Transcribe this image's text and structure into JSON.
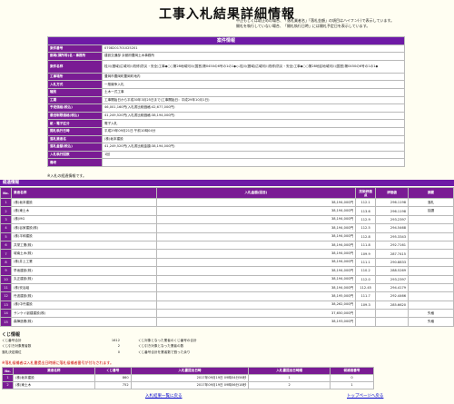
{
  "page": {
    "title": "工事入札結果詳細情報",
    "notes": [
      "中止もしくは取止めの場合、「落札業者名」「落札金額」の項目はハイフン(-)で表示しています。",
      "開札を執行していない場合、「開札執行日時」には開札予定日を表示しています。"
    ]
  },
  "info": {
    "header": "案件情報",
    "rows": [
      {
        "label": "案件番号",
        "value": "0708201701025201"
      },
      {
        "label": "部局(課所等)名・事務所",
        "value": "建設交通部 京都府豊岡土木事務所"
      },
      {
        "label": "案件名称",
        "value": "桂川(圏域)広域河川改修(防災・安全)工事◆○○第28地域河川(国営)第0450の6号の1の1◆◇-桂川(圏域)広域河川改修(防災・安全)工事◆○○第28地区地域河川(国営)第0450の6号の1の1◆"
      },
      {
        "label": "工事場所",
        "value": "豊岡市豊岡町豊岡町地内"
      },
      {
        "label": "入札方式",
        "value": "一般競争入札"
      },
      {
        "label": "種別",
        "value": "土木一式工事"
      },
      {
        "label": "工期",
        "value": "工事開始日から平成30年3月25日まで(工事開始日：平成29年10月1日)"
      },
      {
        "label": "予定価格(税込)",
        "value": "46,001,160円(入札書比較価格:42,677,000円)"
      },
      {
        "label": "最低制限価格(税込)",
        "value": "41,249,520円(入札書比較価格:38,194,000円)"
      },
      {
        "label": "紙・電子区分",
        "value": "電子入札"
      },
      {
        "label": "開札執行日時",
        "value": "平成29年09月21日 午前10時04分"
      },
      {
        "label": "落札業者名",
        "value": "(株)坂本建設"
      },
      {
        "label": "落札金額(税込)",
        "value": "41,249,520円(入札書比較金額:38,194,000円)"
      },
      {
        "label": "入札執行回数",
        "value": "1回"
      },
      {
        "label": "備考",
        "value": ""
      }
    ]
  },
  "caption_kekka": "※入札の経過情報です。",
  "kekka": {
    "section_title": "経過情報",
    "headers": {
      "no": "No.",
      "name": "業者名称",
      "amount": "入札金額(回目)",
      "score": "技術評価点",
      "eval": "評価値",
      "note": "摘要"
    },
    "rows": [
      {
        "no": "1",
        "name": "(株)坂本建設",
        "amount": "38,194,000円",
        "score": "112.1",
        "eval": "296.1198",
        "note": "落札"
      },
      {
        "no": "2",
        "name": "(株)東土木",
        "amount": "38,194,000円",
        "score": "113.6",
        "eval": "296.1198",
        "note": "抽選"
      },
      {
        "no": "3",
        "name": "(株)MG",
        "amount": "38,194,000円",
        "score": "112.9",
        "eval": "293.2397",
        "note": ""
      },
      {
        "no": "4",
        "name": "(株)谷家建設(株)",
        "amount": "38,194,000円",
        "score": "112.5",
        "eval": "294.5468",
        "note": ""
      },
      {
        "no": "5",
        "name": "(株)平和建設",
        "amount": "38,194,000円",
        "score": "112.8",
        "eval": "295.3343",
        "note": ""
      },
      {
        "no": "6",
        "name": "共栄工業(株)",
        "amount": "38,194,000円",
        "score": "111.8",
        "eval": "292.7161",
        "note": ""
      },
      {
        "no": "7",
        "name": "城南土木(株)",
        "amount": "38,194,000円",
        "score": "109.9",
        "eval": "287.7415",
        "note": ""
      },
      {
        "no": "8",
        "name": "(株)井上工業",
        "amount": "38,194,000円",
        "score": "111.1",
        "eval": "290.8833",
        "note": ""
      },
      {
        "no": "9",
        "name": "早坂建設(株)",
        "amount": "38,194,000円",
        "score": "110.2",
        "eval": "288.5269",
        "note": ""
      },
      {
        "no": "10",
        "name": "丸正建設(株)",
        "amount": "38,194,000円",
        "score": "112.0",
        "eval": "293.2397",
        "note": ""
      },
      {
        "no": "11",
        "name": "(株)安谷組",
        "amount": "38,194,000円",
        "score": "112.45",
        "eval": "294.4179",
        "note": ""
      },
      {
        "no": "12",
        "name": "丹波建設(株)",
        "amount": "38,195,000円",
        "score": "111.7",
        "eval": "292.4466",
        "note": ""
      },
      {
        "no": "13",
        "name": "(株)中丹建設",
        "amount": "38,262,000円",
        "score": "109.3",
        "eval": "285.6620",
        "note": ""
      },
      {
        "no": "14",
        "name": "サンケイ創建建設(株)",
        "amount": "37,650,000円",
        "score": "",
        "eval": "",
        "note": "失格"
      },
      {
        "no": "15",
        "name": "森陣造業(株)",
        "amount": "38,193,000円",
        "score": "",
        "eval": "",
        "note": "失格"
      }
    ]
  },
  "kuji": {
    "title": "くじ情報",
    "left": [
      {
        "label": "くじ番号合計",
        "value": "1612"
      },
      {
        "label": "くじ引き対象業者数",
        "value": "2"
      },
      {
        "label": "落札決定順位",
        "value": "0"
      }
    ],
    "right": [
      "くじ対象となった業者のくじ番号の合計",
      "くじ引き対象となった業者の数",
      "くじ番号合計を業者数で割った余り"
    ],
    "warning": "※落札候補者は入札書提出日時順に落札候補者番号が付与されます。",
    "headers": {
      "no": "No.",
      "name": "業者名称",
      "kuji_no": "くじ番号",
      "datetime": "入札書提出日時",
      "order": "入札書提出日時順",
      "cand": "候補者番号"
    },
    "rows": [
      {
        "no": "1",
        "name": "(株)坂本建設",
        "kuji_no": "860",
        "datetime": "2017年09月19日 09時54分56秒",
        "order": "1",
        "cand": "0"
      },
      {
        "no": "2",
        "name": "(株)東土木",
        "kuji_no": "752",
        "datetime": "2017年09月19日 09時56分18秒",
        "order": "2",
        "cand": "1"
      }
    ]
  },
  "links": {
    "back": "入札結果一覧に戻る",
    "top": "トップページへ戻る"
  }
}
